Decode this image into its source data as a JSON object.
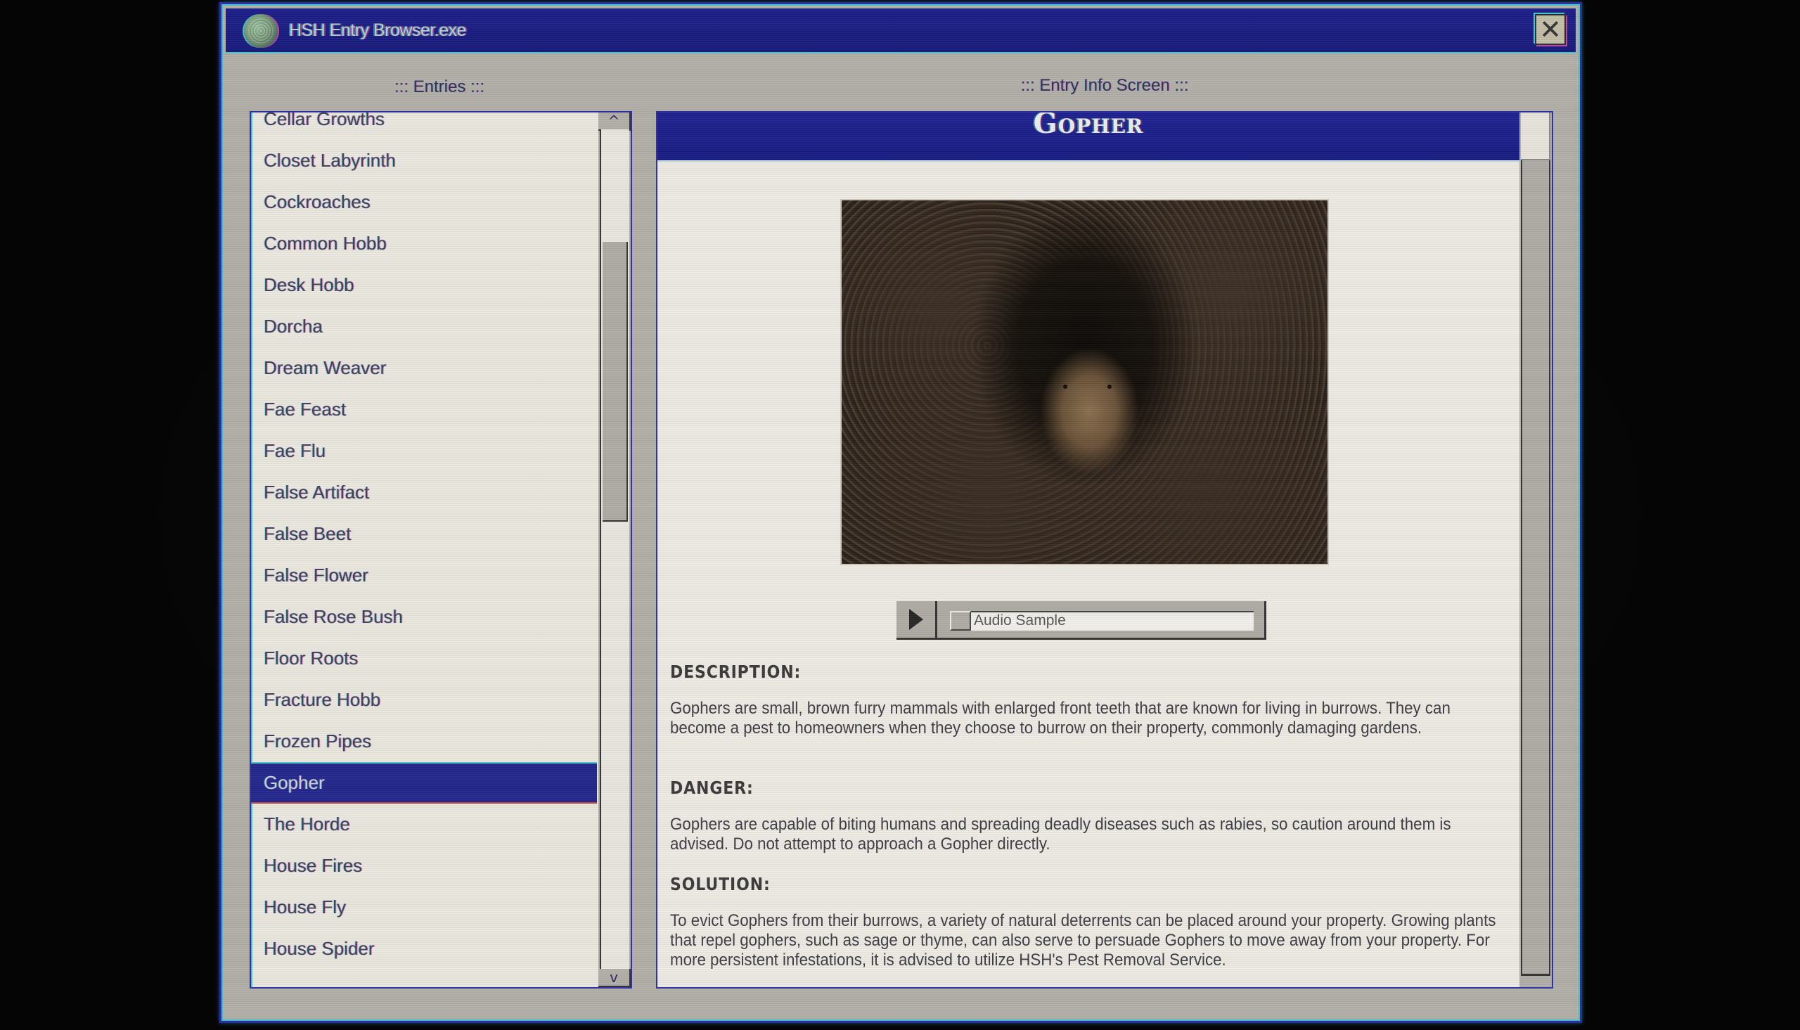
{
  "window": {
    "title": "HSH Entry Browser.exe",
    "icon": "globe-brain-icon",
    "close_symbol": "✕"
  },
  "entries_panel": {
    "label": "::: Entries :::",
    "items": [
      {
        "label": "Cellar Growths",
        "selected": false
      },
      {
        "label": "Closet Labyrinth",
        "selected": false
      },
      {
        "label": "Cockroaches",
        "selected": false
      },
      {
        "label": "Common Hobb",
        "selected": false
      },
      {
        "label": "Desk Hobb",
        "selected": false
      },
      {
        "label": "Dorcha",
        "selected": false
      },
      {
        "label": "Dream Weaver",
        "selected": false
      },
      {
        "label": "Fae Feast",
        "selected": false
      },
      {
        "label": "Fae Flu",
        "selected": false
      },
      {
        "label": "False Artifact",
        "selected": false
      },
      {
        "label": "False Beet",
        "selected": false
      },
      {
        "label": "False Flower",
        "selected": false
      },
      {
        "label": "False Rose Bush",
        "selected": false
      },
      {
        "label": "Floor Roots",
        "selected": false
      },
      {
        "label": "Fracture Hobb",
        "selected": false
      },
      {
        "label": "Frozen Pipes",
        "selected": false
      },
      {
        "label": "Gopher",
        "selected": true
      },
      {
        "label": "The Horde",
        "selected": false
      },
      {
        "label": "House Fires",
        "selected": false
      },
      {
        "label": "House Fly",
        "selected": false
      },
      {
        "label": "House Spider",
        "selected": false
      }
    ],
    "scroll_up_symbol": "^",
    "scroll_down_symbol": "v",
    "scroll_position": 0.2
  },
  "info_panel": {
    "label": "::: Entry Info Screen :::",
    "title": "Gopher",
    "image_alt": "Gopher emerging from a burrow in dark soil",
    "audio": {
      "label": "Audio Sample",
      "play_icon": "play-icon"
    },
    "sections": [
      {
        "heading": "DESCRIPTION:",
        "text": "Gophers are small, brown furry mammals with enlarged front teeth that are known for living in burrows. They can become a pest to homeowners when they choose to burrow on their property, commonly damaging gardens."
      },
      {
        "heading": "DANGER:",
        "text": "Gophers are capable of biting humans and spreading deadly diseases such as rabies, so caution around them is advised. Do not attempt to approach a Gopher directly."
      },
      {
        "heading": "SOLUTION:",
        "text": "To evict Gophers from their burrows, a variety of natural deterrents can be placed around your property. Growing plants that repel gophers, such as sage or thyme, can also serve to persuade Gophers to move away from your property. For more persistent infestations, it is advised to utilize HSH's Pest Removal Service."
      }
    ],
    "scroll_position": 0.0
  },
  "colors": {
    "title_bar": "#1c1e8a",
    "selection": "#22268c",
    "window_face": "#b3b0aa",
    "panel_bg": "#ece9e1"
  }
}
